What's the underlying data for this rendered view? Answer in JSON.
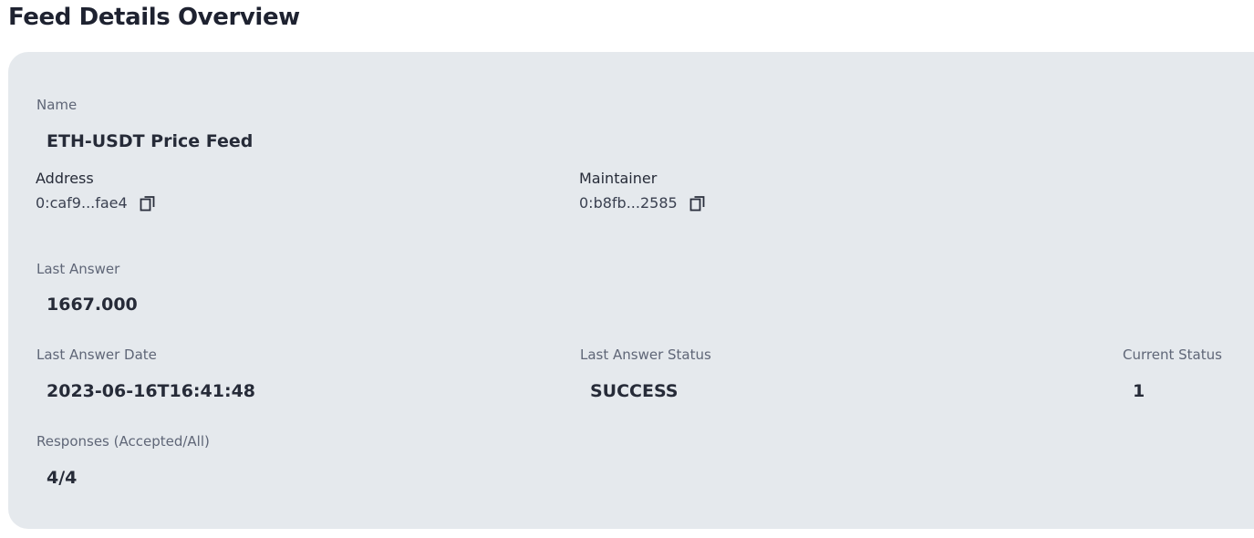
{
  "page": {
    "title": "Feed Details Overview"
  },
  "feed": {
    "name_label": "Name",
    "name_value": "ETH-USDT Price Feed",
    "address_label": "Address",
    "address_value": "0:caf9...fae4",
    "maintainer_label": "Maintainer",
    "maintainer_value": "0:b8fb...2585",
    "last_answer_label": "Last Answer",
    "last_answer_value": "1667.000",
    "last_answer_date_label": "Last Answer Date",
    "last_answer_date_value": "2023-06-16T16:41:48",
    "last_answer_status_label": "Last Answer Status",
    "last_answer_status_value": "SUCCESS",
    "current_status_label": "Current Status",
    "current_status_value": "1",
    "responses_label": "Responses (Accepted/All)",
    "responses_value": "4/4"
  },
  "icons": {
    "copy": "copy-icon"
  },
  "colors": {
    "card_bg": "#e5e9ed",
    "text_dark": "#262b38",
    "text_label": "#5f6677"
  }
}
